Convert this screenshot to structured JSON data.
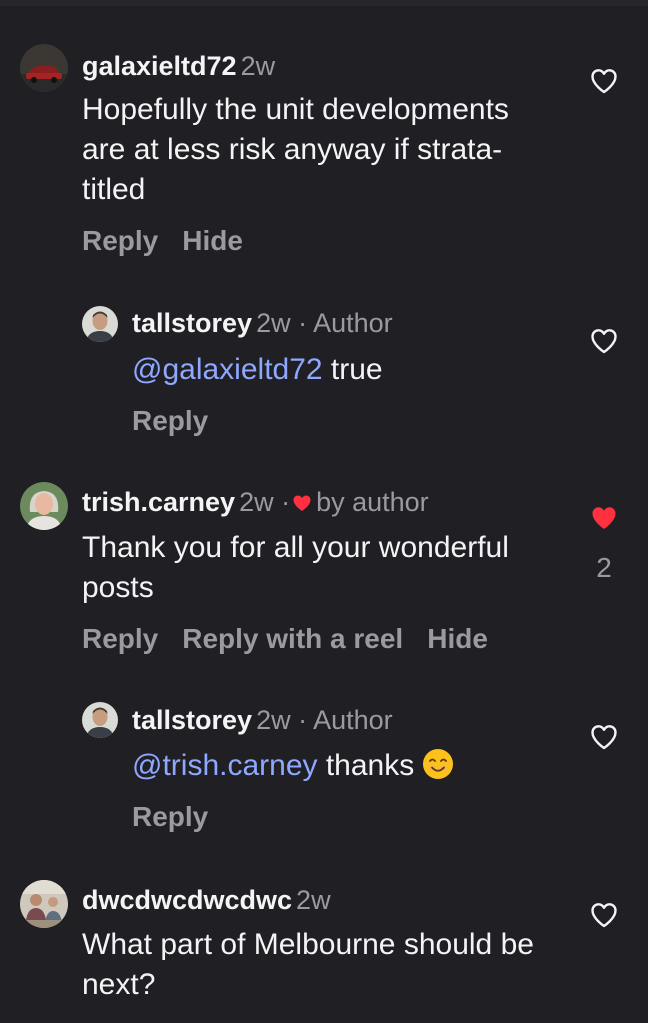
{
  "colors": {
    "background": "#1f1f24",
    "text": "#f4f4f6",
    "muted": "#9a9aa0",
    "mention": "#8fa8ff",
    "liked_heart": "#ff3040"
  },
  "comments": [
    {
      "username": "galaxieltd72",
      "meta": "2w",
      "text": "Hopefully the unit developments are at less risk anyway if strata-titled",
      "actions": [
        "Reply",
        "Hide"
      ],
      "like_icon": "heart-outline-icon"
    },
    {
      "username": "tallstorey",
      "meta": "2w · Author",
      "mention": "@galaxieltd72",
      "text": " true",
      "actions": [
        "Reply"
      ],
      "like_icon": "heart-outline-icon"
    },
    {
      "username": "trish.carney",
      "meta": "2w ·",
      "liked_badge": "by author",
      "text": "Thank you for all your wonderful posts",
      "actions": [
        "Reply",
        "Reply with a reel",
        "Hide"
      ],
      "like_icon": "heart-filled-icon",
      "like_count": "2"
    },
    {
      "username": "tallstorey",
      "meta": "2w · Author",
      "mention": "@trish.carney",
      "text": " thanks",
      "emoji": "smiling-face-emoji",
      "actions": [
        "Reply"
      ],
      "like_icon": "heart-outline-icon"
    },
    {
      "username": "dwcdwcdwcdwc",
      "meta": "2w",
      "text": "What part of Melbourne should be next?",
      "like_icon": "heart-outline-icon"
    }
  ]
}
